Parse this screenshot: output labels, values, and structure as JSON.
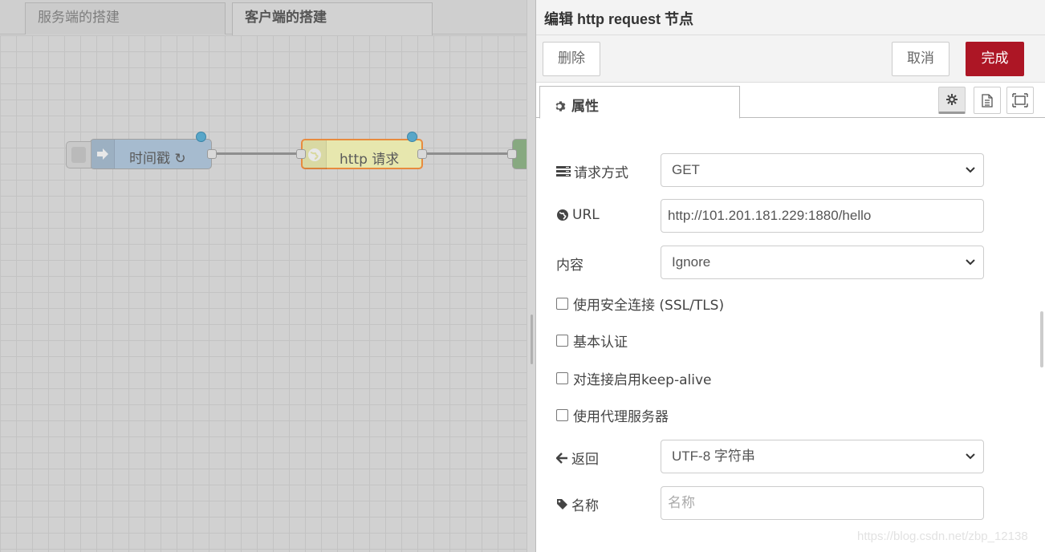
{
  "workspace": {
    "tabs": [
      {
        "label": "服务端的搭建",
        "active": false
      },
      {
        "label": "客户端的搭建",
        "active": true
      }
    ],
    "nodes": {
      "inject": {
        "label": "时间戳 ↻",
        "color": "#a6bbcf"
      },
      "http_request": {
        "label": "http 请求",
        "color": "#e7e7ae"
      },
      "debug": {
        "color": "#87a980"
      }
    }
  },
  "panel": {
    "title": "编辑 http request 节点",
    "buttons": {
      "delete": "删除",
      "cancel": "取消",
      "done": "完成"
    },
    "tab_properties": "属性",
    "side_icons": [
      "gear-icon",
      "document-icon",
      "frame-icon"
    ],
    "form": {
      "method": {
        "label": "请求方式",
        "value": "GET"
      },
      "url": {
        "label": "URL",
        "value": "http://101.201.181.229:1880/hello"
      },
      "payload": {
        "label": "内容",
        "value": "Ignore"
      },
      "ssl": {
        "label": "使用安全连接 (SSL/TLS)",
        "checked": false
      },
      "basic_auth": {
        "label": "基本认证",
        "checked": false
      },
      "keep_alive": {
        "label": "对连接启用keep-alive",
        "checked": false
      },
      "proxy": {
        "label": "使用代理服务器",
        "checked": false
      },
      "return": {
        "label": "返回",
        "value": "UTF-8 字符串"
      },
      "name": {
        "label": "名称",
        "value": "",
        "placeholder": "名称"
      }
    }
  },
  "watermark": "https://blog.csdn.net/zbp_12138",
  "colors": {
    "done_button": "#ad1625",
    "status_dot": "#58a6c8",
    "canvas_bg": "#d1d1d1"
  }
}
